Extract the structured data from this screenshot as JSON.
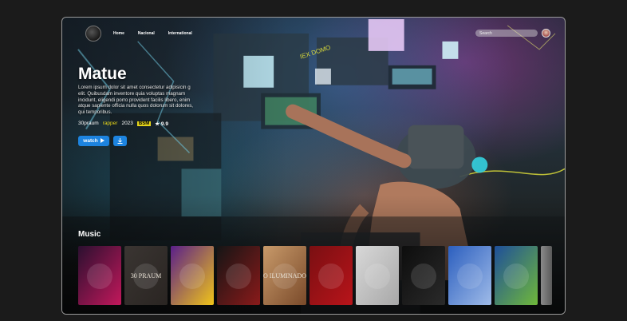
{
  "nav": {
    "items": [
      "Home",
      "Nacional",
      "International"
    ]
  },
  "search": {
    "placeholder": "Search"
  },
  "hero": {
    "title": "Matue",
    "description": "Lorem ipsum dolor sit amet consectetur adipisicin g elit. Quibusdam inventore quia voluptas magnam incidunt, eligendi porro provident facilis libero, enim atque sapiente officia nulla quos dolorum sit dolores, qui temporibus.",
    "artist": "30praum",
    "genre": "rapper",
    "year": "2023",
    "badge": "BSM",
    "rating": "★ 9.9",
    "watch_label": "watch",
    "watch_icon": "play-icon",
    "download_icon": "download-icon"
  },
  "music": {
    "label": "Music",
    "albums": [
      {
        "cover_text": "",
        "colors": [
          "#2b1030",
          "#c2185b"
        ]
      },
      {
        "cover_text": "30 PRAUM",
        "colors": [
          "#3a3532",
          "#2a2522"
        ]
      },
      {
        "cover_text": "",
        "colors": [
          "#5a1f8a",
          "#f0c419"
        ]
      },
      {
        "cover_text": "",
        "colors": [
          "#151515",
          "#8a1a1a"
        ]
      },
      {
        "cover_text": "O ILUMINADO",
        "colors": [
          "#c89a6a",
          "#7a4a2a"
        ]
      },
      {
        "cover_text": "",
        "colors": [
          "#7a0f12",
          "#b8141a"
        ]
      },
      {
        "cover_text": "",
        "colors": [
          "#d8d8d8",
          "#a8a8a8"
        ]
      },
      {
        "cover_text": "",
        "colors": [
          "#0d0d0d",
          "#2a2a2a"
        ]
      },
      {
        "cover_text": "",
        "colors": [
          "#2c5fbf",
          "#9fbbe8"
        ]
      },
      {
        "cover_text": "",
        "colors": [
          "#1e4f9a",
          "#6fb83a"
        ]
      }
    ]
  }
}
